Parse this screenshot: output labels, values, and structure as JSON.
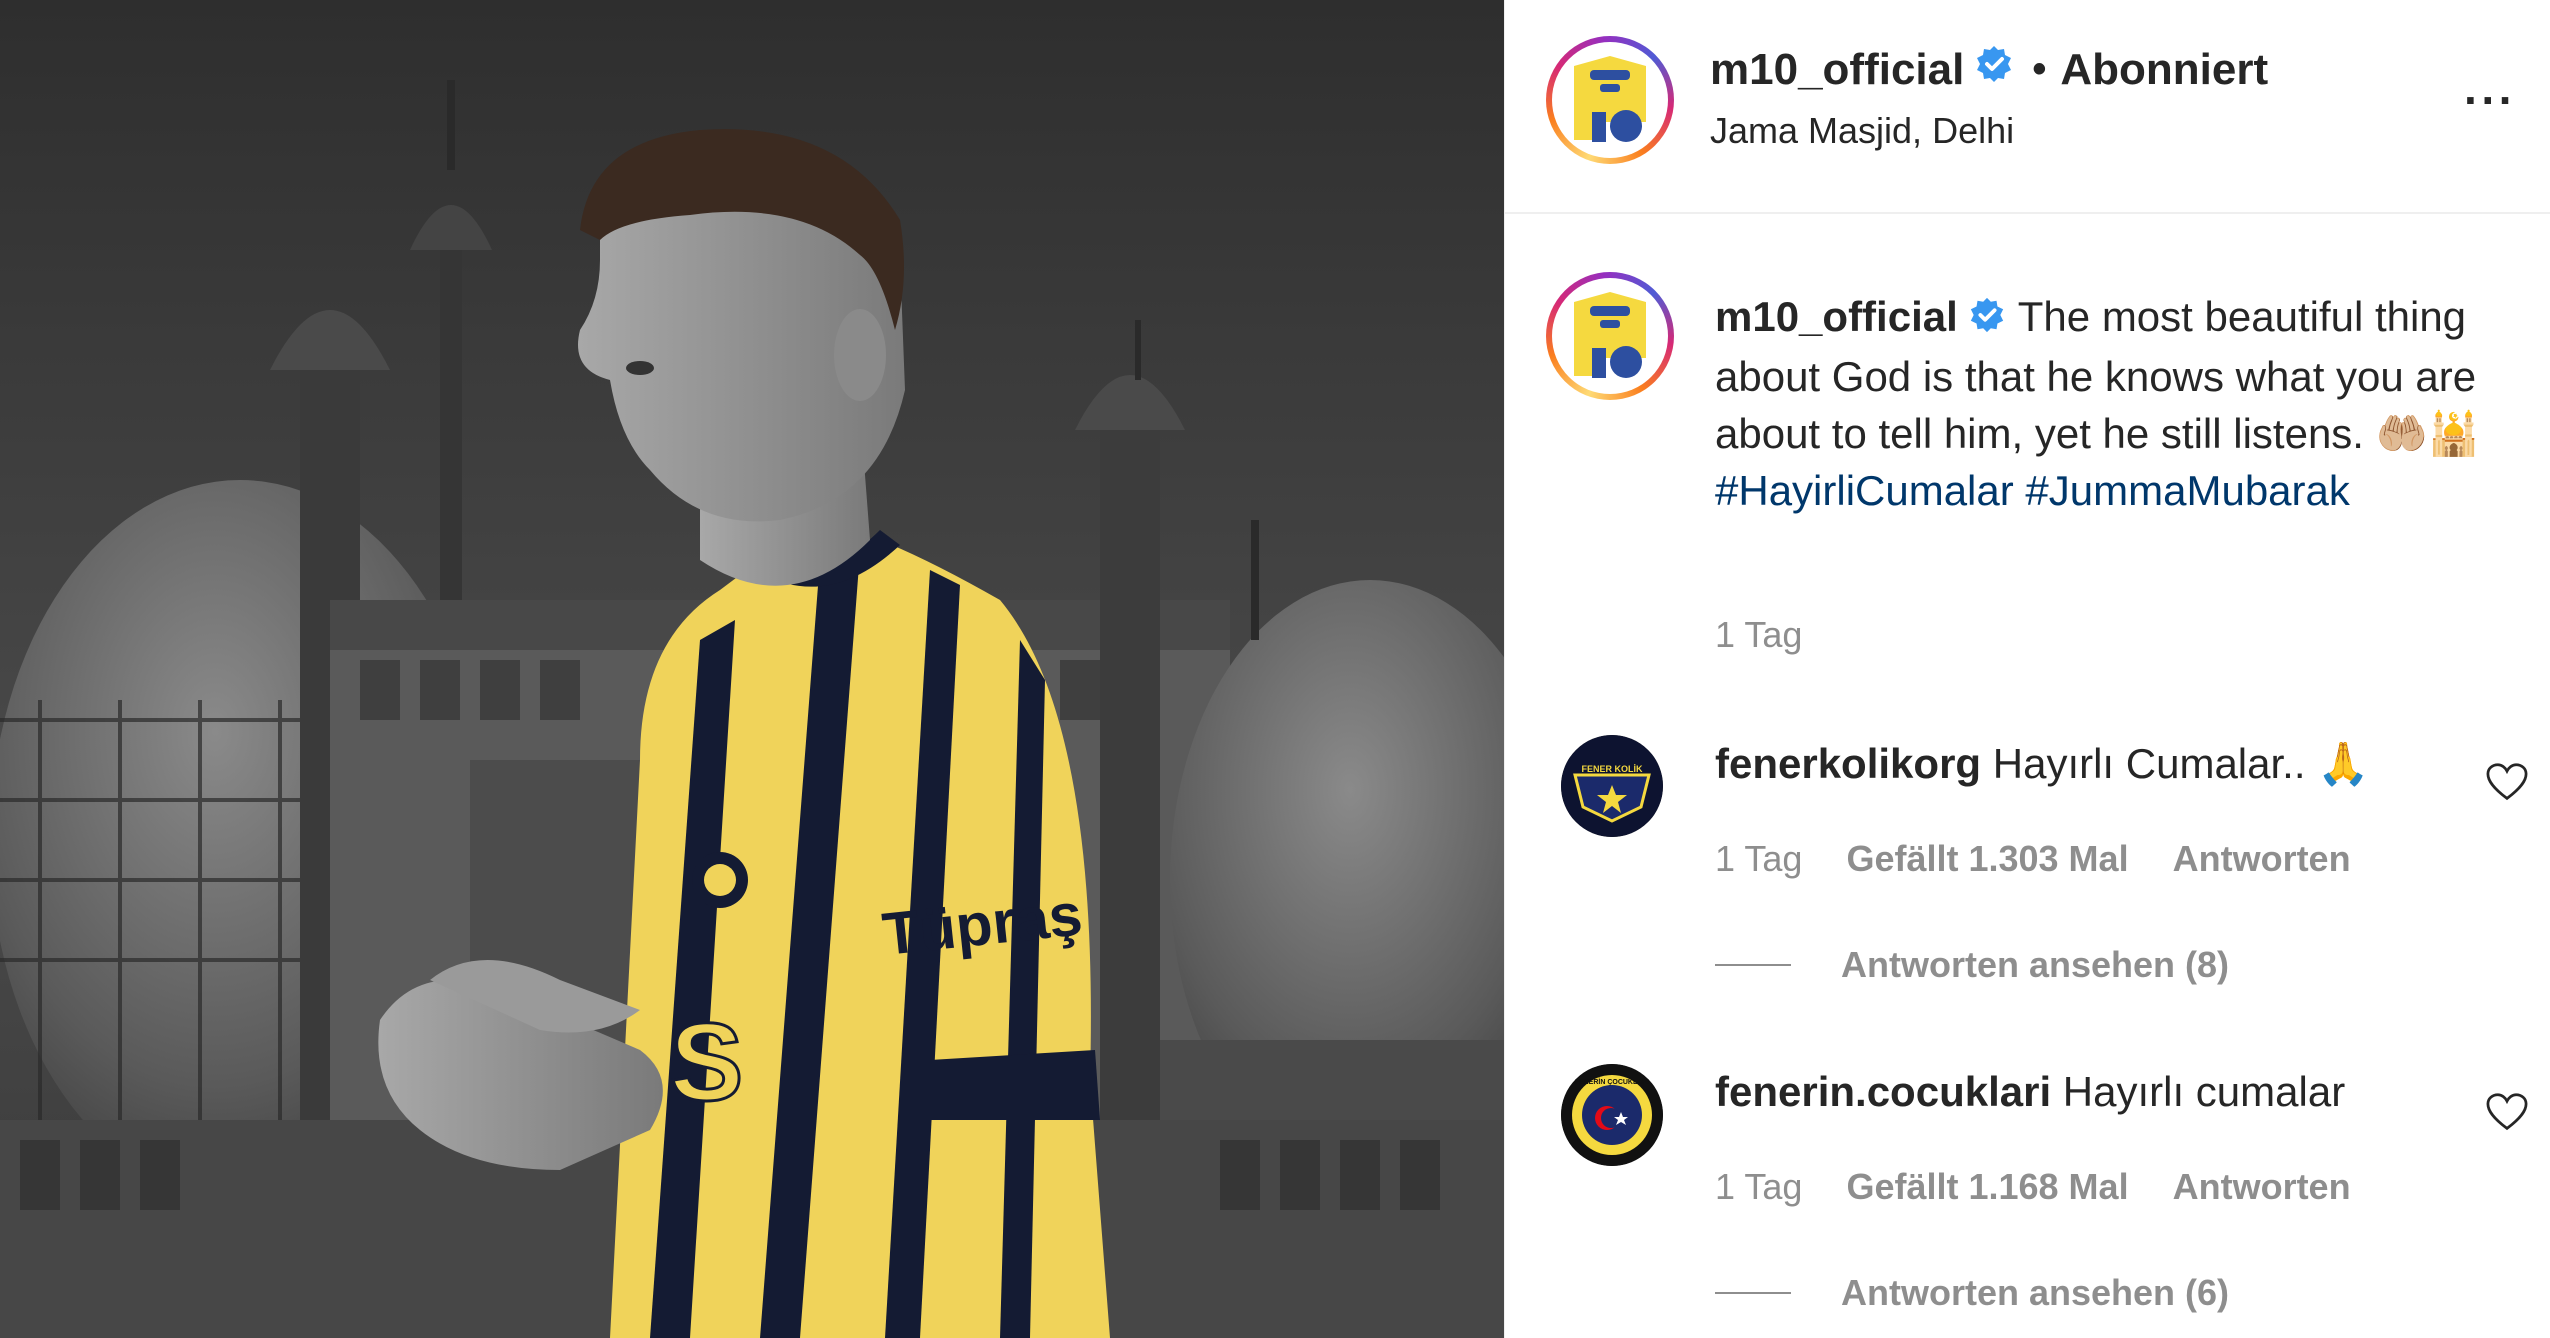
{
  "header": {
    "username": "m10_official",
    "separator": "•",
    "follow_state": "Abonniert",
    "location": "Jama Masjid, Delhi",
    "more_icon": "more-horizontal-icon",
    "more_glyph": "···"
  },
  "caption": {
    "username": "m10_official",
    "text": "The most beautiful thing about God is that he knows what you are about to tell him, yet he still listens. 🤲🏼🕌",
    "hashtags": [
      "#HayirliCumalar",
      "#JummaMubarak"
    ],
    "time": "1 Tag"
  },
  "photo": {
    "shirt_sponsor": "Tüpraş"
  },
  "comments": [
    {
      "username": "fenerkolikorg",
      "text": "Hayırlı Cumalar.. 🙏",
      "avatar_text": "FENER KOLİK",
      "time": "1 Tag",
      "likes": "Gefällt 1.303 Mal",
      "reply_label": "Antworten",
      "view_replies": "Antworten ansehen (8)"
    },
    {
      "username": "fenerin.cocuklari",
      "text": "Hayırlı cumalar",
      "avatar_text": "FENERİN ÇOCUKLARI",
      "time": "1 Tag",
      "likes": "Gefällt 1.168 Mal",
      "reply_label": "Antworten",
      "view_replies": "Antworten ansehen (6)"
    }
  ],
  "colors": {
    "hashtag": "#00376b",
    "muted": "#8e8e8e",
    "verified": "#3897f0",
    "jersey_yellow": "#f0d35a",
    "jersey_navy": "#141b33"
  }
}
